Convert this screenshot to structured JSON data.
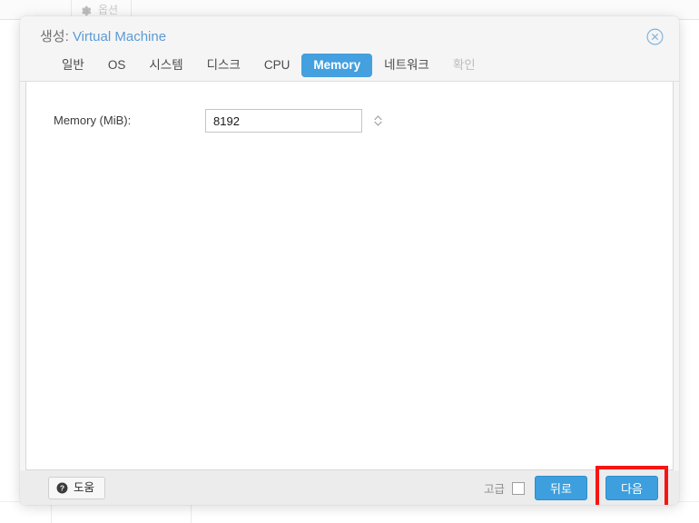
{
  "background": {
    "toolbar": {
      "option_label": "옵션",
      "gear_icon": "gear-icon"
    }
  },
  "dialog": {
    "title_prefix": "생성:",
    "title_value": "Virtual Machine",
    "close_icon": "close-circle-icon",
    "tabs": [
      {
        "label": "일반",
        "state": "normal"
      },
      {
        "label": "OS",
        "state": "normal"
      },
      {
        "label": "시스템",
        "state": "normal"
      },
      {
        "label": "디스크",
        "state": "normal"
      },
      {
        "label": "CPU",
        "state": "normal"
      },
      {
        "label": "Memory",
        "state": "active"
      },
      {
        "label": "네트워크",
        "state": "normal"
      },
      {
        "label": "확인",
        "state": "disabled"
      }
    ],
    "content": {
      "memory_field": {
        "label": "Memory (MiB):",
        "value": "8192",
        "placeholder": ""
      }
    },
    "footer": {
      "help_label": "도움",
      "help_icon": "question-circle-icon",
      "advanced_label": "고급",
      "advanced_checked": false,
      "back_label": "뒤로",
      "next_label": "다음"
    }
  },
  "colors": {
    "accent_blue": "#3d9fdd",
    "tab_active_blue": "#44a0df",
    "title_blue": "#5b9bd5",
    "highlight_red": "#f71414",
    "dialog_bg": "#f5f5f5",
    "footer_bg": "#ececec",
    "content_bg": "#ffffff"
  }
}
